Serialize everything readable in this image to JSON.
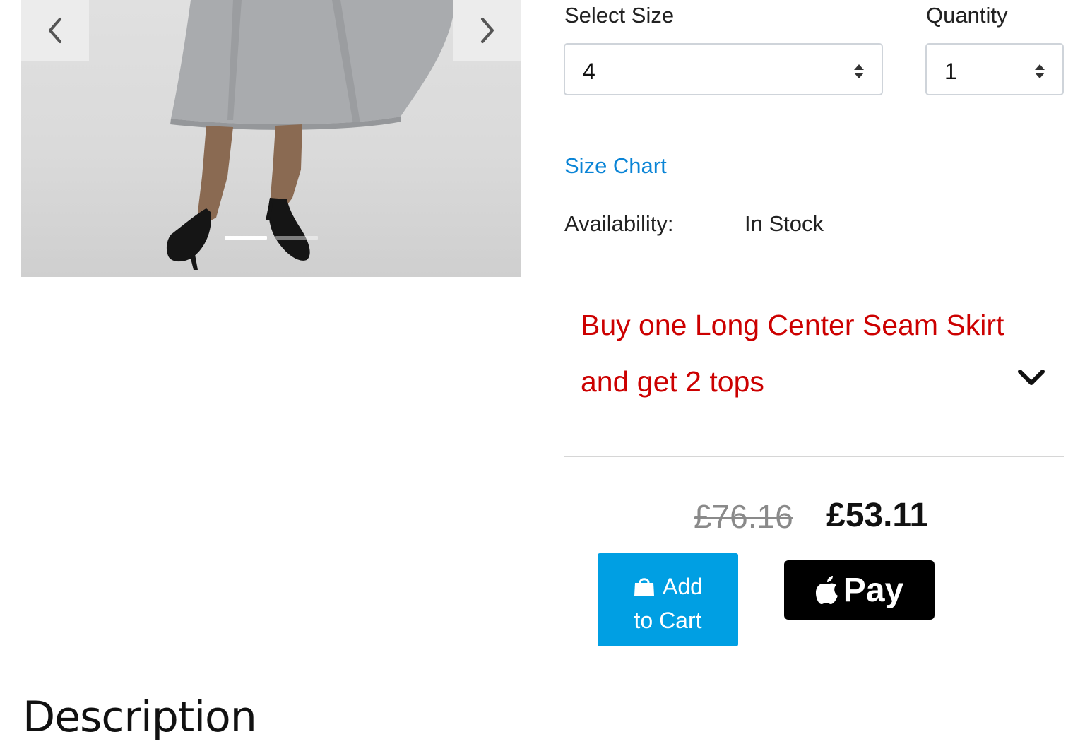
{
  "gallery": {
    "prev_icon": "chevron-left-icon",
    "next_icon": "chevron-right-icon",
    "slides_total": 2,
    "active_slide": 1
  },
  "size": {
    "label": "Select Size",
    "value": "4"
  },
  "quantity": {
    "label": "Quantity",
    "value": "1"
  },
  "size_chart_link": "Size Chart",
  "availability": {
    "label": "Availability:",
    "value": "In Stock"
  },
  "promo": {
    "line1": "Buy one Long Center Seam Skirt",
    "line2": "and get 2 tops",
    "color": "#cc0000",
    "toggle_icon": "chevron-down-icon"
  },
  "price": {
    "original": "£76.16",
    "current": "£53.11"
  },
  "add_to_cart": {
    "line1": "Add",
    "line2": "to Cart",
    "icon": "shopping-bag-icon",
    "color": "#009fe3"
  },
  "apple_pay": {
    "label": "Pay",
    "icon": "apple-logo-icon"
  },
  "description_heading": "Description"
}
